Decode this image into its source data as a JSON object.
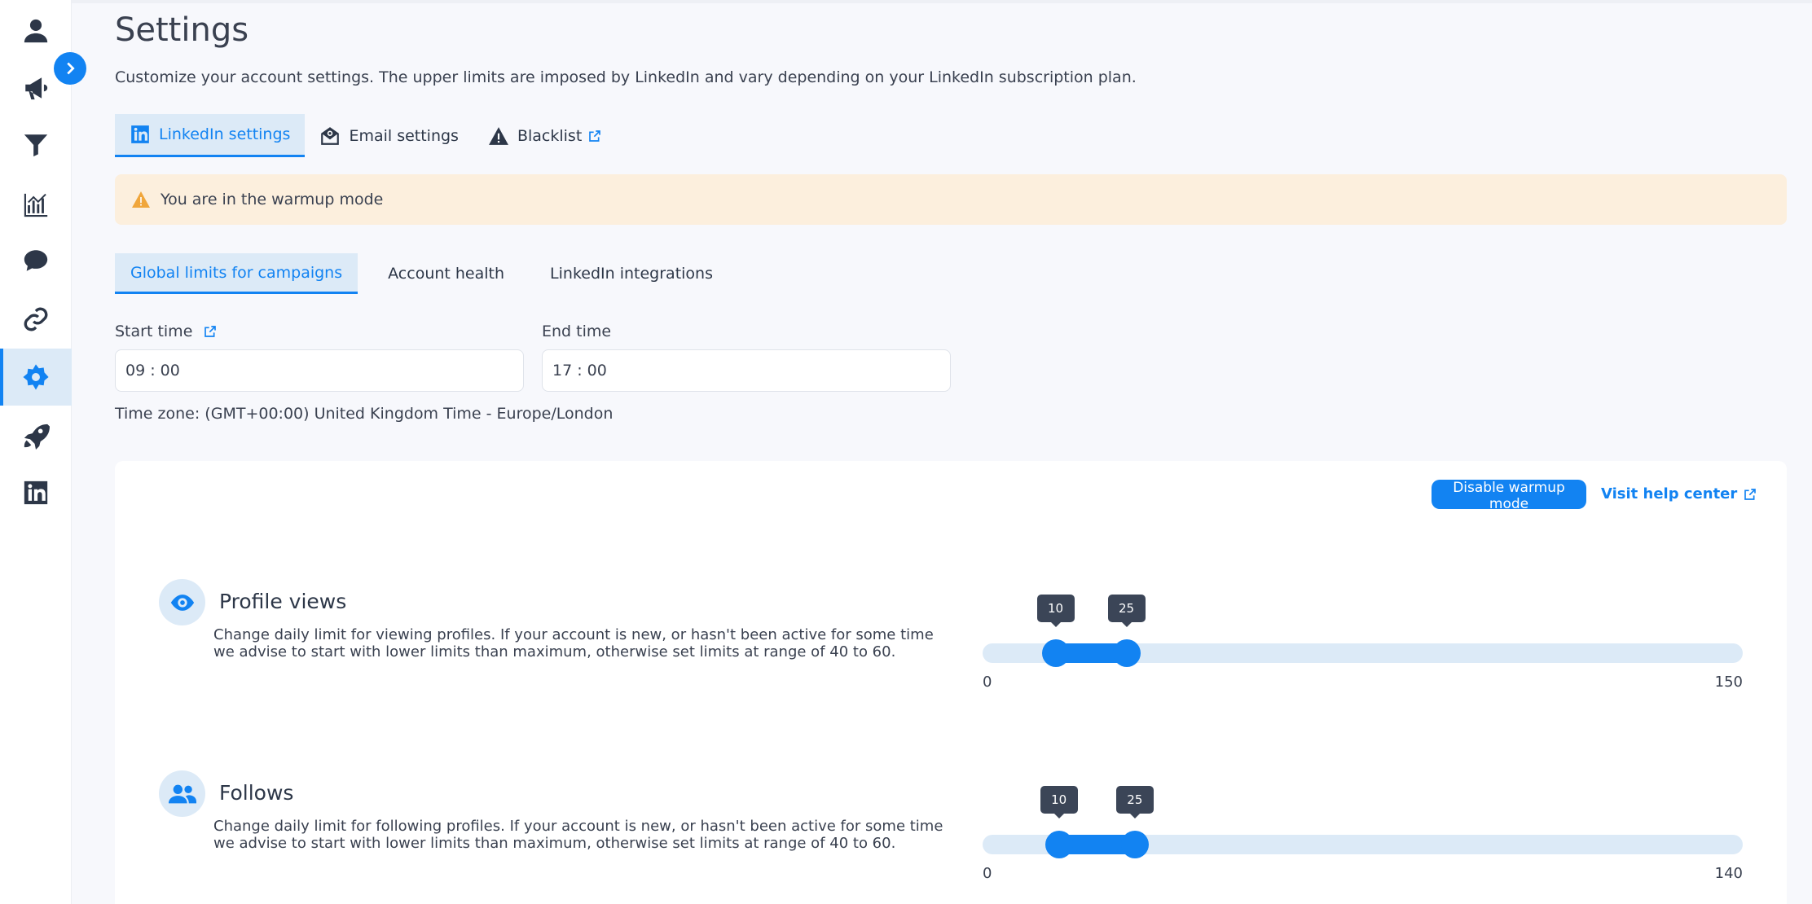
{
  "sidebar": {
    "items": [
      {
        "icon": "person-icon"
      },
      {
        "icon": "megaphone-icon"
      },
      {
        "icon": "filter-icon"
      },
      {
        "icon": "chart-icon"
      },
      {
        "icon": "chat-icon"
      },
      {
        "icon": "link-icon"
      },
      {
        "icon": "gear-icon",
        "active": true
      },
      {
        "icon": "rocket-icon"
      },
      {
        "icon": "linkedin-icon"
      }
    ]
  },
  "page": {
    "title": "Settings",
    "description": "Customize your account settings. The upper limits are imposed by LinkedIn and vary depending on your LinkedIn subscription plan."
  },
  "tabs": [
    {
      "label": "LinkedIn settings",
      "icon": "linkedin-icon",
      "active": true
    },
    {
      "label": "Email settings",
      "icon": "email-icon"
    },
    {
      "label": "Blacklist",
      "icon": "warning-icon"
    }
  ],
  "banner": {
    "text": "You are in the warmup mode",
    "color": "#fcefdd"
  },
  "subtabs": [
    {
      "label": "Global limits for campaigns",
      "active": true
    },
    {
      "label": "Account health"
    },
    {
      "label": "LinkedIn integrations"
    }
  ],
  "schedule": {
    "start_label": "Start time",
    "start_value": "09 : 00",
    "end_label": "End time",
    "end_value": "17 : 00",
    "timezone": "Time zone: (GMT+00:00) United Kingdom Time - Europe/London"
  },
  "card": {
    "disable_button": "Disable warmup mode",
    "help_link": "Visit help center"
  },
  "limits": [
    {
      "title": "Profile views",
      "icon": "eye-icon",
      "description": "Change daily limit for viewing profiles. If your account is new, or hasn't been active for some time we advise to start with lower limits than maximum, otherwise set limits at range of 40 to 60.",
      "min": 0,
      "max": 150,
      "low": 10,
      "high": 25,
      "min_label": "0",
      "max_label": "150",
      "low_label": "10",
      "high_label": "25"
    },
    {
      "title": "Follows",
      "icon": "users-icon",
      "description": "Change daily limit for following profiles. If your account is new, or hasn't been active for some time we advise to start with lower limits than maximum, otherwise set limits at range of 40 to 60.",
      "min": 0,
      "max": 140,
      "low": 10,
      "high": 25,
      "min_label": "0",
      "max_label": "140",
      "low_label": "10",
      "high_label": "25"
    }
  ],
  "colors": {
    "accent": "#1283f2",
    "accent_light": "#dceaf7",
    "text": "#3a4150"
  }
}
